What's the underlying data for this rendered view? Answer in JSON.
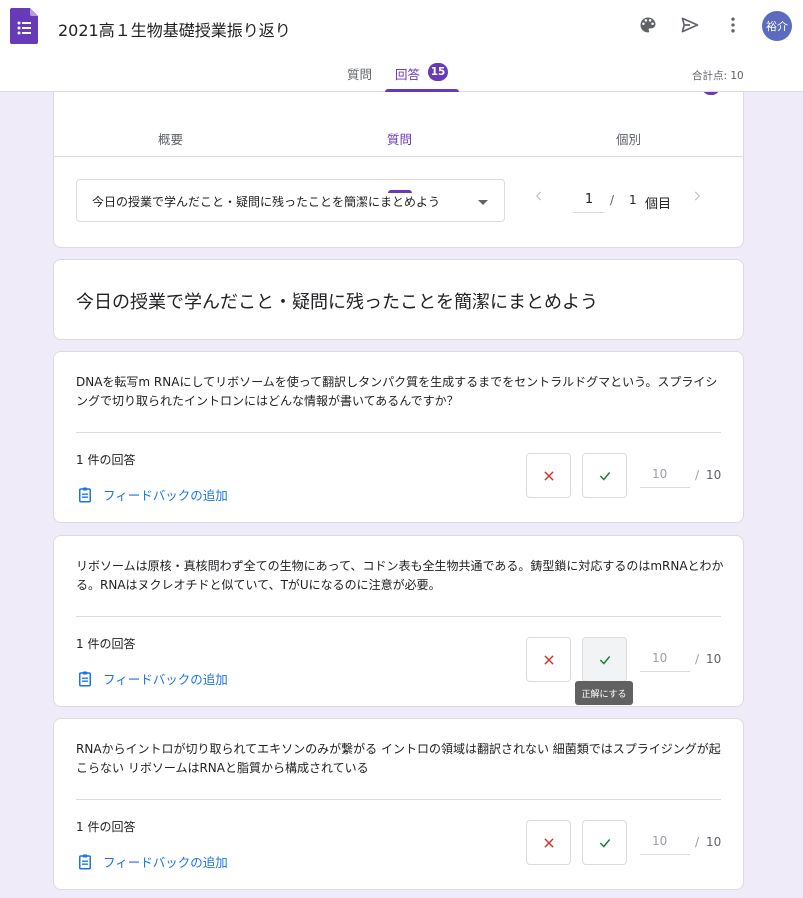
{
  "header": {
    "doc_title": "2021高１生物基礎授業振り返り",
    "avatar_text": "裕介",
    "tabs": {
      "questions": "質問",
      "responses": "回答",
      "response_count": "15"
    },
    "total_points": "合計点: 10"
  },
  "summary": {
    "sub_tabs": {
      "overview": "概要",
      "question": "質問",
      "individual": "個別"
    },
    "question_select": "今日の授業で学んだこと・疑問に残ったことを簡潔にまとめよう",
    "pager": {
      "current": "1",
      "separator": "/",
      "total": "1",
      "unit": "個目"
    }
  },
  "question_title": "今日の授業で学んだこと・疑問に残ったことを簡潔にまとめよう",
  "responses": [
    {
      "text": "DNAを転写m RNAにしてリボソームを使って翻訳しタンパク質を生成するまでをセントラルドグマという。スプライシングで切り取られたイントロンにはどんな情報が書いてあるんですか？",
      "count": "1 件の回答",
      "feedback": "フィードバックの追加",
      "score_placeholder": "10",
      "score_sep": "/",
      "score_max": "10"
    },
    {
      "text": "リボソームは原核・真核問わず全ての生物にあって、コドン表も全生物共通である。鋳型鎖に対応するのはmRNAとわかる。RNAはヌクレオチドと似ていて、TがUになるのに注意が必要。",
      "count": "1 件の回答",
      "feedback": "フィードバックの追加",
      "score_placeholder": "10",
      "score_sep": "/",
      "score_max": "10"
    },
    {
      "text": "RNAからイントロが切り取られてエキソンのみが繋がる イントロの領域は翻訳されない 細菌類ではスプライジングが起こらない リボソームはRNAと脂質から構成されている",
      "count": "1 件の回答",
      "feedback": "フィードバックの追加",
      "score_placeholder": "10",
      "score_sep": "/",
      "score_max": "10"
    }
  ],
  "tooltip": "正解にする",
  "colors": {
    "accent": "#673ab7",
    "background": "#f0ebf8",
    "link": "#1a73e8",
    "wrong": "#d93025",
    "right": "#188038"
  },
  "icons": [
    "forms-app-icon",
    "palette-icon",
    "send-icon",
    "more-vert-icon",
    "chevron-left-icon",
    "chevron-right-icon",
    "close-icon",
    "check-icon",
    "feedback-clipboard-icon",
    "dropdown-caret-icon"
  ]
}
